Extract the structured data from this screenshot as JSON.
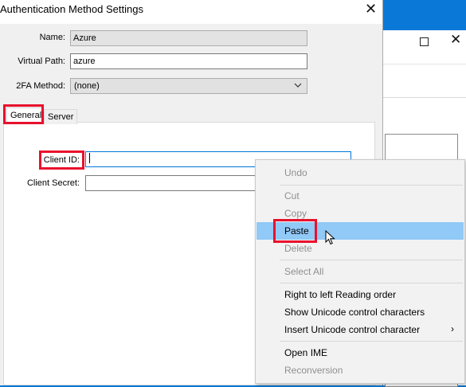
{
  "background_window": {
    "maximize_icon": "square-icon",
    "close_icon": "close-icon"
  },
  "dialog": {
    "title": "Authentication Method Settings",
    "close_glyph": "✕",
    "name_label": "Name:",
    "name_value": "Azure",
    "virtual_path_label": "Virtual Path:",
    "virtual_path_value": "azure",
    "twofa_label": "2FA Method:",
    "twofa_value": "(none)",
    "tabs": [
      "General",
      "Server"
    ],
    "client_id_label": "Client ID:",
    "client_id_value": "",
    "client_secret_label": "Client Secret:",
    "client_secret_value": ""
  },
  "context_menu": {
    "items": [
      {
        "label": "Undo",
        "enabled": false
      },
      {
        "label": "Cut",
        "enabled": false
      },
      {
        "label": "Copy",
        "enabled": false
      },
      {
        "label": "Paste",
        "enabled": true,
        "highlighted": true
      },
      {
        "label": "Delete",
        "enabled": false
      },
      {
        "label": "Select All",
        "enabled": false
      },
      {
        "label": "Right to left Reading order",
        "enabled": true
      },
      {
        "label": "Show Unicode control characters",
        "enabled": true
      },
      {
        "label": "Insert Unicode control character",
        "enabled": true,
        "submenu": true
      },
      {
        "label": "Open IME",
        "enabled": true
      },
      {
        "label": "Reconversion",
        "enabled": false
      }
    ],
    "submenu_glyph": "›"
  },
  "colors": {
    "desktop": "#0a78d7",
    "highlight": "#91c9f7",
    "annotation_red": "#e8112d"
  }
}
